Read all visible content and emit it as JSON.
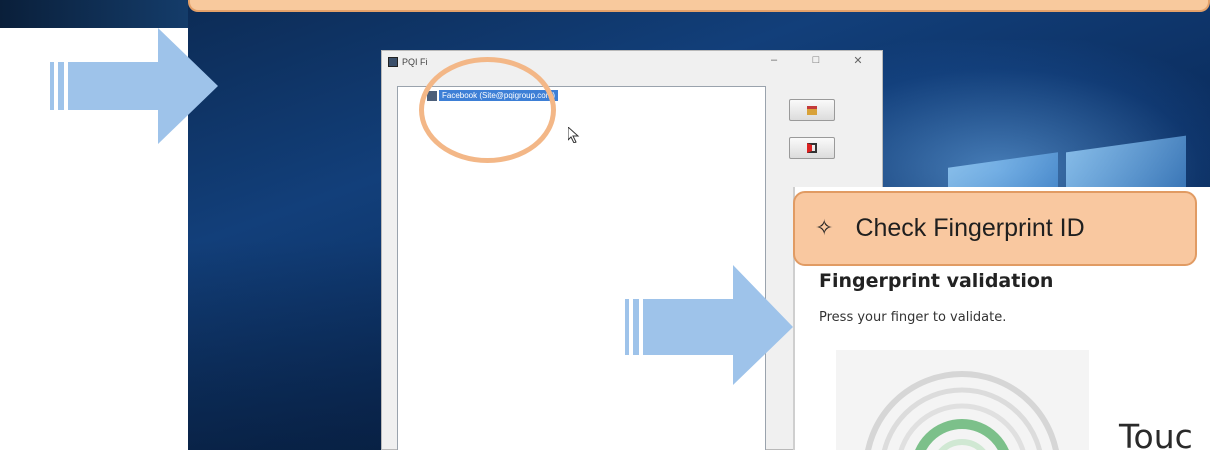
{
  "pq_window": {
    "title": "PQI Fi",
    "minimize": "–",
    "maximize": "□",
    "close": "✕",
    "list_item_label": "Facebook (Site@pqigroup.com)",
    "gift_icon": "gift-icon",
    "exit_icon": "exit-door-icon"
  },
  "callout": {
    "icon": "✧",
    "label": "Check Fingerprint ID"
  },
  "fingerprint_dialog": {
    "title": "Fingerprint validation",
    "subtitle": "Press your finger to validate.",
    "touch_text": "Touc"
  },
  "colors": {
    "callout_fill": "#f9c8a0",
    "callout_border": "#e19b63",
    "arrow": "#9ec3ea",
    "highlight_ring": "#f3b787",
    "selection": "#3d7fd6"
  }
}
